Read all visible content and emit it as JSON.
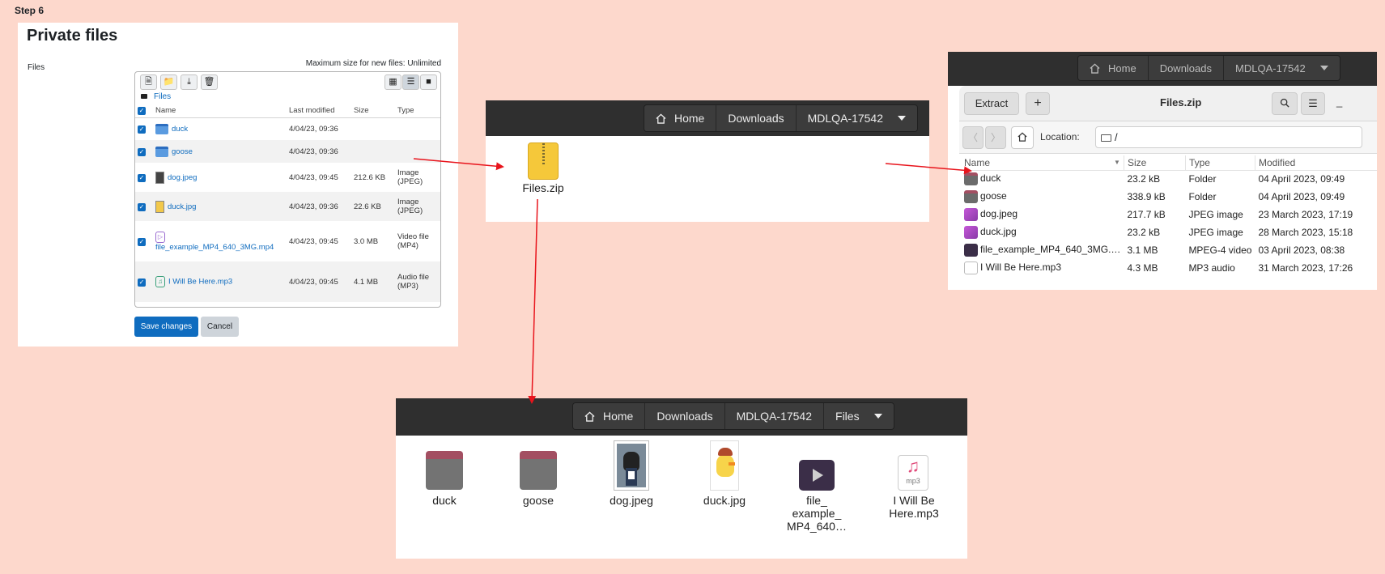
{
  "step": "Step 6",
  "moodle": {
    "title": "Private files",
    "files_label": "Files",
    "max_size": "Maximum size for new files: Unlimited",
    "breadcrumb": "Files",
    "columns": [
      "Name",
      "Last modified",
      "Size",
      "Type"
    ],
    "rows": [
      {
        "name": "duck",
        "modified": "4/04/23, 09:36",
        "size": "",
        "type": "",
        "icon": "folder-icon"
      },
      {
        "name": "goose",
        "modified": "4/04/23, 09:36",
        "size": "",
        "type": "",
        "icon": "folder-icon"
      },
      {
        "name": "dog.jpeg",
        "modified": "4/04/23, 09:45",
        "size": "212.6 KB",
        "type": "Image (JPEG)",
        "icon": "image-icon"
      },
      {
        "name": "duck.jpg",
        "modified": "4/04/23, 09:36",
        "size": "22.6 KB",
        "type": "Image (JPEG)",
        "icon": "image-icon"
      },
      {
        "name": "file_example_MP4_640_3MG.mp4",
        "modified": "4/04/23, 09:45",
        "size": "3.0 MB",
        "type": "Video file (MP4)",
        "icon": "video-icon"
      },
      {
        "name": "I Will Be Here.mp3",
        "modified": "4/04/23, 09:45",
        "size": "4.1 MB",
        "type": "Audio file (MP3)",
        "icon": "audio-icon"
      }
    ],
    "save_label": "Save changes",
    "cancel_label": "Cancel"
  },
  "mid_window": {
    "path": [
      "Home",
      "Downloads",
      "MDLQA-17542"
    ],
    "item": "Files.zip"
  },
  "right_window": {
    "path": [
      "Home",
      "Downloads",
      "MDLQA-17542"
    ],
    "extract_label": "Extract",
    "title": "Files.zip",
    "location_label": "Location:",
    "location_value": "/",
    "columns": [
      "Name",
      "Size",
      "Type",
      "Modified"
    ],
    "rows": [
      {
        "name": "duck",
        "size": "23.2 kB",
        "type": "Folder",
        "modified": "04 April 2023, 09:49",
        "icon": "folder"
      },
      {
        "name": "goose",
        "size": "338.9 kB",
        "type": "Folder",
        "modified": "04 April 2023, 09:49",
        "icon": "folder"
      },
      {
        "name": "dog.jpeg",
        "size": "217.7 kB",
        "type": "JPEG image",
        "modified": "23 March 2023, 17:19",
        "icon": "img"
      },
      {
        "name": "duck.jpg",
        "size": "23.2 kB",
        "type": "JPEG image",
        "modified": "28 March 2023, 15:18",
        "icon": "img"
      },
      {
        "name": "file_example_MP4_640_3MG.…",
        "size": "3.1 MB",
        "type": "MPEG-4 video",
        "modified": "03 April 2023, 08:38",
        "icon": "vid"
      },
      {
        "name": "I Will Be Here.mp3",
        "size": "4.3 MB",
        "type": "MP3 audio",
        "modified": "31 March 2023, 17:26",
        "icon": "aud"
      }
    ]
  },
  "bottom_window": {
    "path": [
      "Home",
      "Downloads",
      "MDLQA-17542",
      "Files"
    ],
    "items": [
      "duck",
      "goose",
      "dog.jpeg",
      "duck.jpg",
      "file_\nexample_\nMP4_640…",
      "I Will Be\nHere.mp3"
    ]
  },
  "colors": {
    "background": "#fdd8cc",
    "arrow": "#e8141c",
    "moodle_blue": "#0f6cbf"
  }
}
